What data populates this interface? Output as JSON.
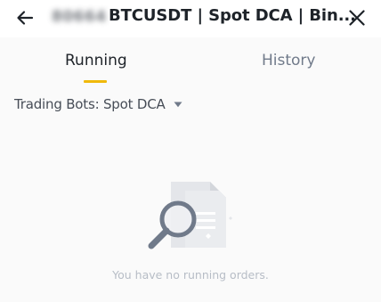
{
  "header": {
    "blurred_id": "80664",
    "title": "BTCUSDT | Spot DCA | Bin..."
  },
  "tabs": [
    {
      "label": "Running",
      "active": true
    },
    {
      "label": "History",
      "active": false
    }
  ],
  "filter": {
    "label": "Trading Bots: Spot DCA"
  },
  "empty_state": {
    "message": "You have no running orders."
  },
  "colors": {
    "accent": "#f0b90b",
    "text_primary": "#1e2329",
    "text_secondary": "#707a8a",
    "text_muted": "#b7bdc6",
    "background": "#fafafa"
  },
  "icons": {
    "back": "arrow-left-icon",
    "close": "close-icon",
    "caret": "caret-down-icon",
    "empty": "document-magnifier-icon"
  }
}
